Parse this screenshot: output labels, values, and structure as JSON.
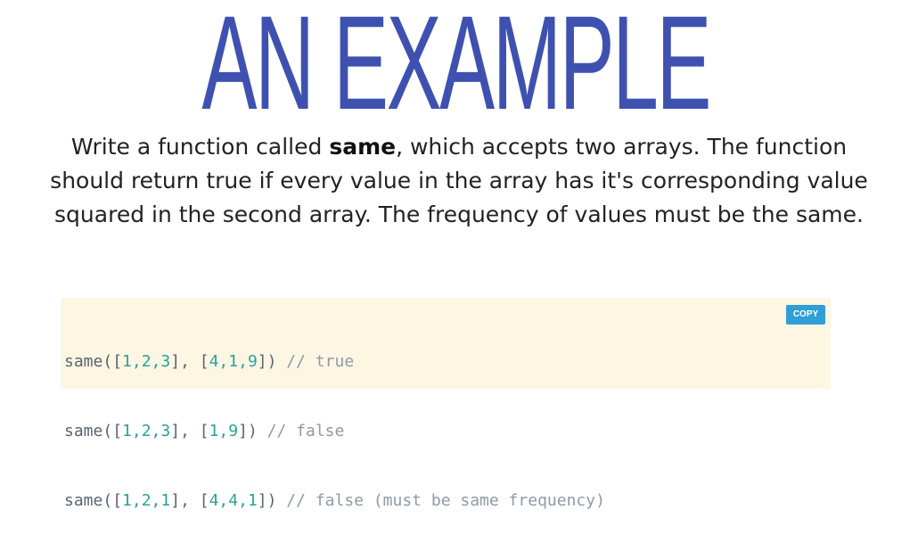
{
  "slide": {
    "title": "AN EXAMPLE",
    "description": {
      "before_bold": "Write a function called ",
      "bold": "same",
      "after_bold": ", which accepts two arrays. The function should return true if every value in the array has it's corresponding value squared in the second array. The frequency of values must be the same."
    }
  },
  "code_panel": {
    "copy_label": "COPY",
    "lines": [
      {
        "fn": "same",
        "open": "([",
        "arr1": "1,2,3",
        "mid": "], [",
        "arr2": "4,1,9",
        "close": "])",
        "comment": " // true"
      },
      {
        "fn": "same",
        "open": "([",
        "arr1": "1,2,3",
        "mid": "], [",
        "arr2": "1,9",
        "close": "])",
        "comment": " // false"
      },
      {
        "fn": "same",
        "open": "([",
        "arr1": "1,2,1",
        "mid": "], [",
        "arr2": "4,4,1",
        "close": "])",
        "comment": " // false (must be same frequency)"
      }
    ]
  },
  "colors": {
    "title": "#3f51b0",
    "code_background": "#fdf6e3",
    "copy_button": "#2f9fd5",
    "code_numbers": "#2aa198",
    "code_comment": "#8f9aa5"
  }
}
